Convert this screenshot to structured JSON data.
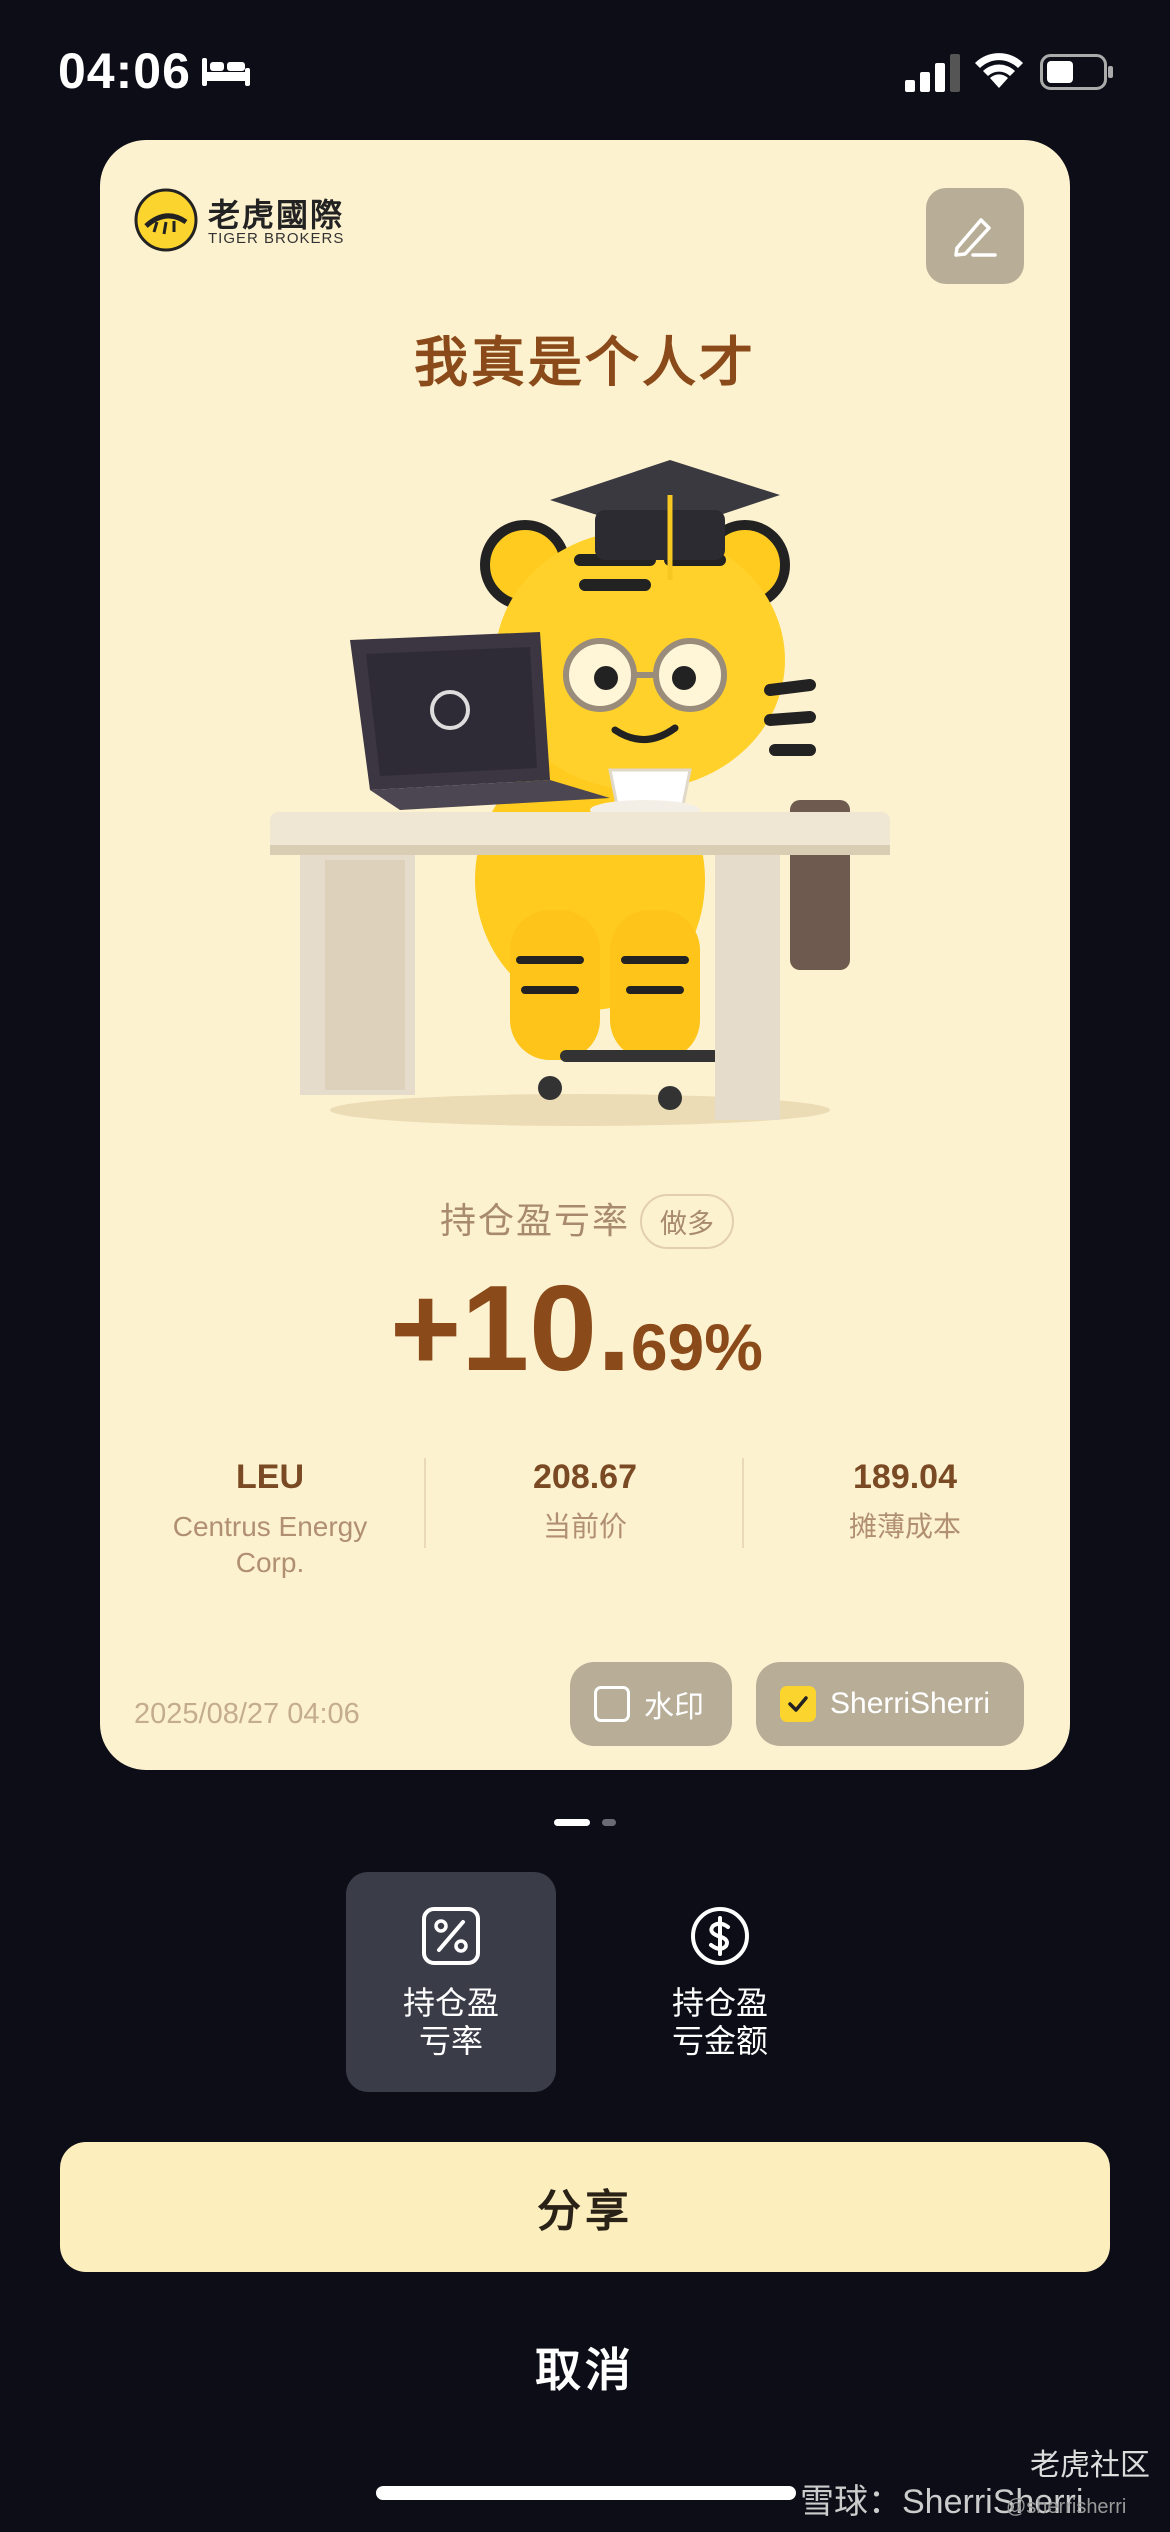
{
  "status_bar": {
    "time": "04:06",
    "icons": [
      "bed-icon",
      "cellular-signal-icon",
      "wifi-icon",
      "battery-icon"
    ]
  },
  "card": {
    "brand_cn": "老虎國際",
    "brand_en": "TIGER BROKERS",
    "headline": "我真是个人才",
    "pnl_label": "持仓盈亏率",
    "position_tag": "做多",
    "pnl_integer": "+10.",
    "pnl_decimal": "69%",
    "stats": [
      {
        "value": "LEU",
        "label": "Centrus Energy Corp."
      },
      {
        "value": "208.67",
        "label": "当前价"
      },
      {
        "value": "189.04",
        "label": "摊薄成本"
      }
    ],
    "date": "2025/08/27 04:06",
    "watermark_option": {
      "label": "水印",
      "checked": false
    },
    "username_option": {
      "label": "SherriSherri",
      "checked": true
    },
    "colors": {
      "card_bg": "#fdf2d0",
      "accent": "#8a4a1a",
      "check": "#fbd42e"
    }
  },
  "pager": {
    "pages": 2,
    "current": 1
  },
  "modes": [
    {
      "label_line1": "持仓盈",
      "label_line2": "亏率",
      "icon": "percent-icon",
      "active": true
    },
    {
      "label_line1": "持仓盈",
      "label_line2": "亏金额",
      "icon": "dollar-icon",
      "active": false
    }
  ],
  "actions": {
    "share": "分享",
    "cancel": "取消"
  },
  "watermarks": {
    "forum": "老虎社区",
    "xueqiu": "雪球：SherriSherri",
    "handle": "@sherrisherri"
  }
}
